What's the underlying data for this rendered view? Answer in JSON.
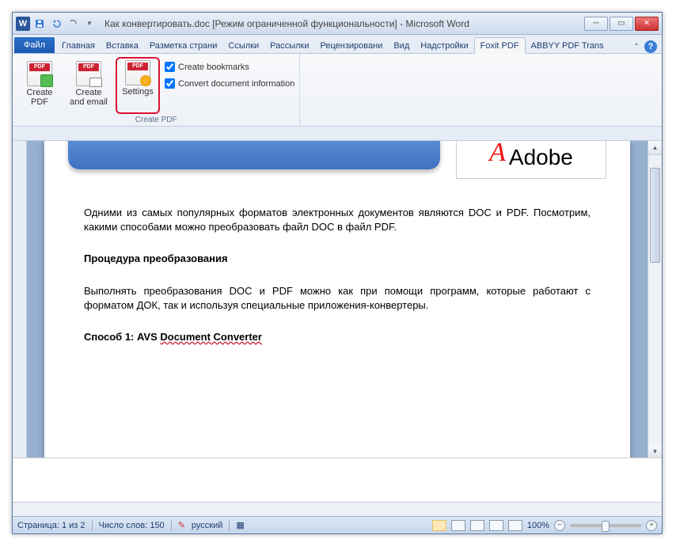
{
  "title": "Как конвертировать.doc [Режим ограниченной функциональности]  -  Microsoft Word",
  "qat": {
    "word": "W"
  },
  "tabs": {
    "file": "Файл",
    "items": [
      "Главная",
      "Вставка",
      "Разметка страни",
      "Ссылки",
      "Рассылки",
      "Рецензировани",
      "Вид",
      "Надстройки",
      "Foxit PDF",
      "ABBYY PDF Trans"
    ],
    "active_index": 8
  },
  "ribbon": {
    "group_label": "Create PDF",
    "btn_create": "Create PDF",
    "btn_email": "Create and email",
    "btn_settings": "Settings",
    "chk_bookmarks": "Create bookmarks",
    "chk_docinfo": "Convert document information"
  },
  "doc": {
    "adobe": "Adobe",
    "p1": "Одними из самых популярных форматов электронных документов являются DOC и PDF. Посмотрим, какими способами можно преобразовать файл DOC в файл PDF.",
    "h1": "Процедура преобразования",
    "p2": "Выполнять преобразования DOC и PDF можно как при помощи программ, которые работают с форматом ДОК, так и используя специальные приложения-конвертеры.",
    "h2a": "Способ 1: AVS ",
    "h2b": "Document Converter"
  },
  "status": {
    "page": "Страница: 1 из 2",
    "words": "Число слов: 150",
    "lang": "русский",
    "zoom": "100%"
  }
}
